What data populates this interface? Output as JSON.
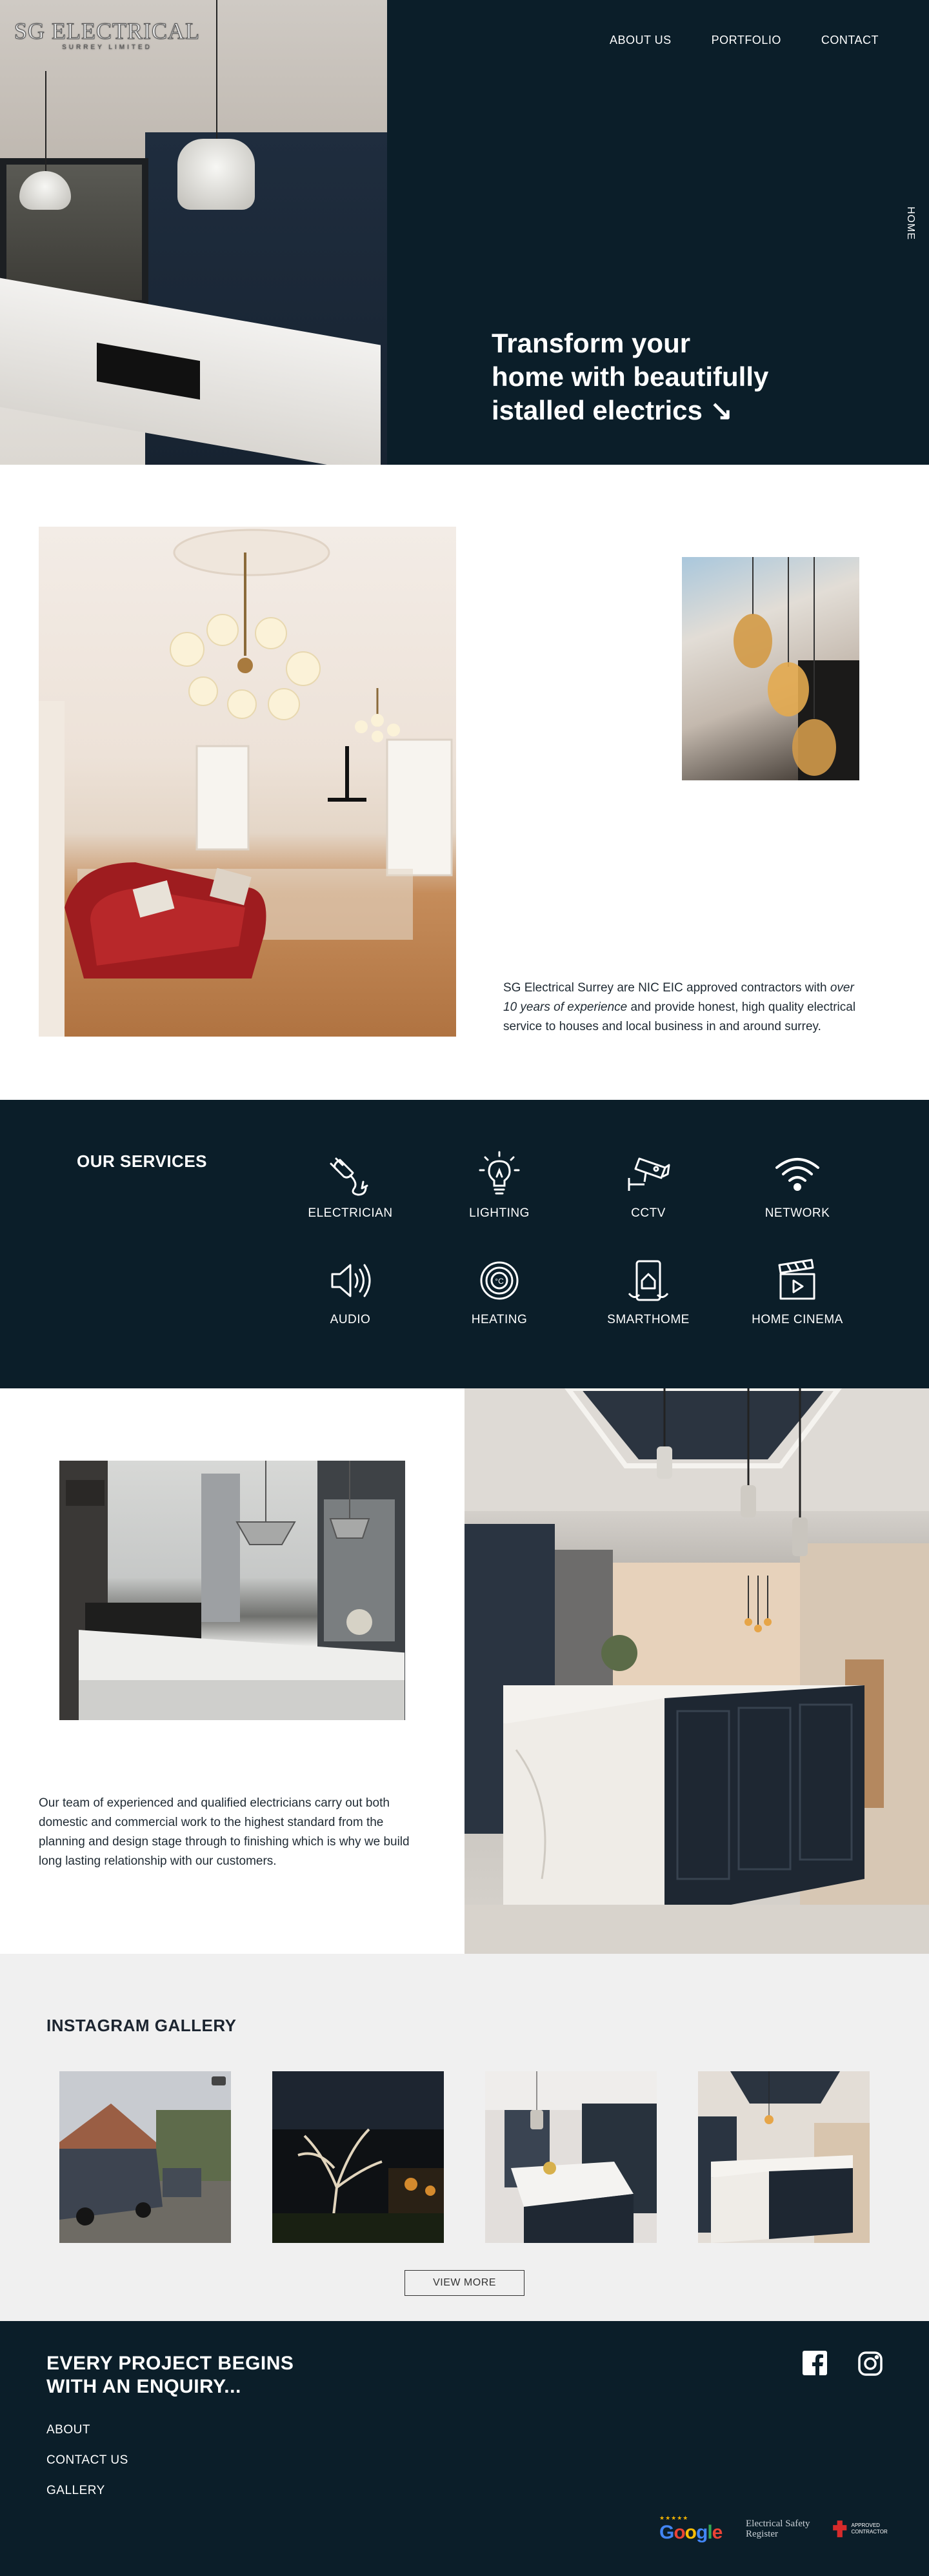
{
  "brand": {
    "logo_main": "SG ELECTRICAL",
    "logo_sub": "SURREY LIMITED"
  },
  "nav": {
    "items": [
      {
        "label": "ABOUT US"
      },
      {
        "label": "PORTFOLIO"
      },
      {
        "label": "CONTACT"
      }
    ],
    "side_label": "HOME"
  },
  "hero": {
    "heading_bold_1": "Transform your",
    "heading_bold_2": "home",
    "heading_rest_2": " with beautifully",
    "heading_line_3": "istalled electrics ↘"
  },
  "about": {
    "text_1": "SG Electrical Surrey are NIC EIC approved contractors with ",
    "text_em": "over 10 years of experience",
    "text_2": " and provide honest, high quality electrical service to houses and local business in and around surrey."
  },
  "services": {
    "title": "OUR SERVICES",
    "items": [
      {
        "label": "ELECTRICIAN",
        "icon": "plug-icon"
      },
      {
        "label": "LIGHTING",
        "icon": "lightbulb-icon"
      },
      {
        "label": "CCTV",
        "icon": "cctv-camera-icon"
      },
      {
        "label": "NETWORK",
        "icon": "wifi-icon"
      },
      {
        "label": "AUDIO",
        "icon": "speaker-icon"
      },
      {
        "label": "HEATING",
        "icon": "thermostat-icon"
      },
      {
        "label": "SMARTHOME",
        "icon": "smartphone-home-icon"
      },
      {
        "label": "HOME CINEMA",
        "icon": "clapperboard-icon"
      }
    ]
  },
  "project": {
    "text": "Our team of experienced and qualified electricians carry out both domestic and commercial work to the highest standard from the planning and design stage through to finishing which is why we build long lasting relationship with our customers.",
    "carousel_index": 1,
    "carousel_count": 3
  },
  "instagram": {
    "title": "INSTAGRAM GALLERY",
    "view_more": "VIEW MORE"
  },
  "footer": {
    "title_line_1": "EVERY PROJECT BEGINS",
    "title_line_2": "WITH AN ENQUIRY...",
    "links": [
      {
        "label": "ABOUT"
      },
      {
        "label": "CONTACT US"
      },
      {
        "label": "GALLERY"
      }
    ],
    "badges": {
      "google_word": "Google",
      "esr_line_1": "Electrical Safety",
      "esr_line_2": "Register",
      "nic_text": "APPROVED CONTRACTOR"
    }
  },
  "colors": {
    "navy": "#0b1e29",
    "light_gray": "#f0f0f0",
    "white": "#ffffff"
  }
}
